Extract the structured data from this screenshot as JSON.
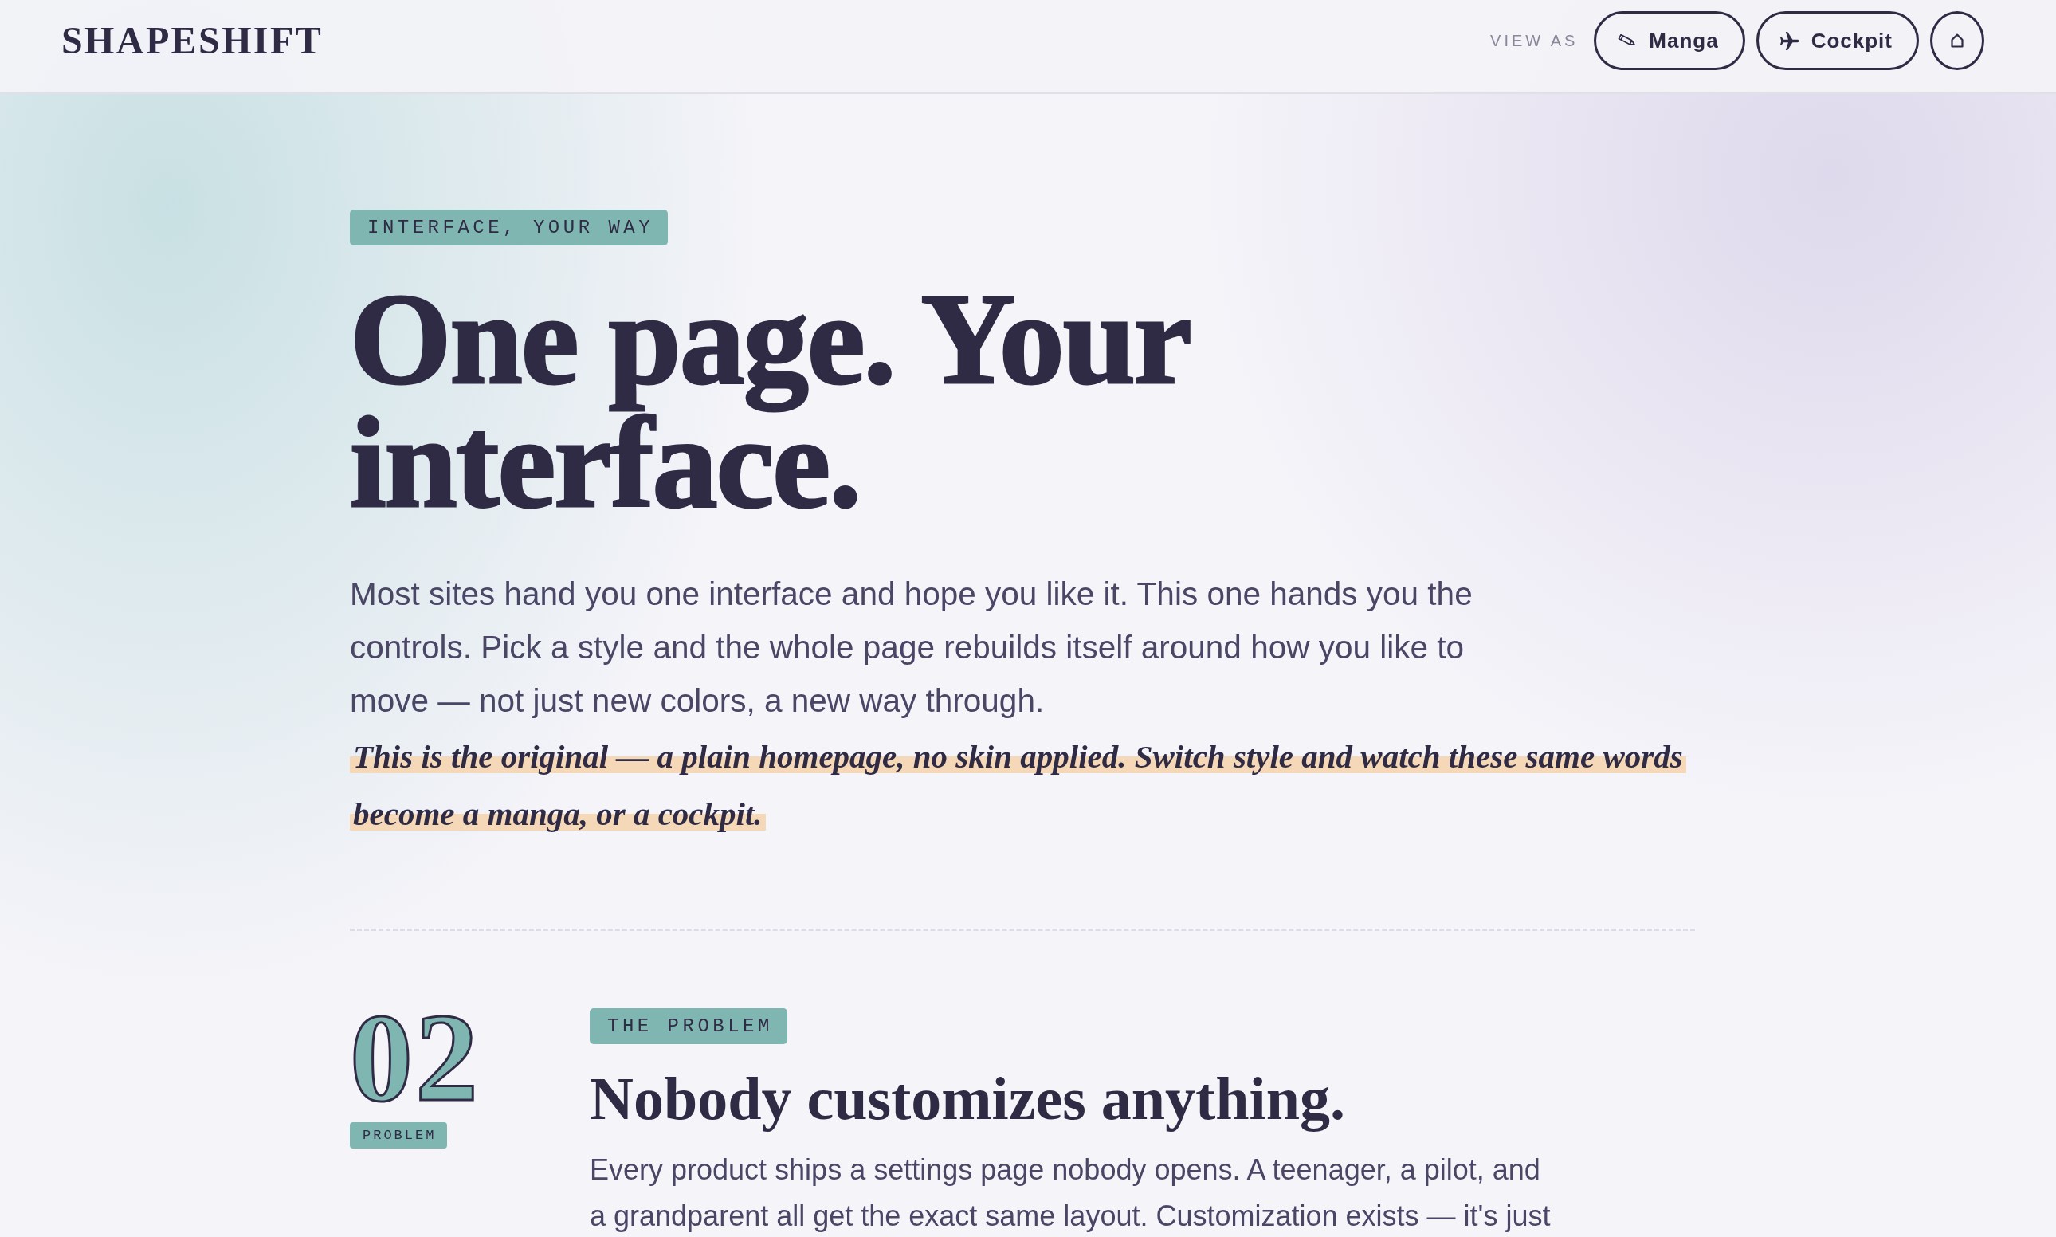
{
  "header": {
    "logo": "SHAPESHIFT",
    "view_label": "VIEW AS",
    "view_buttons": [
      {
        "kind": "manga",
        "label": "Manga"
      },
      {
        "kind": "cockpit",
        "label": "Cockpit"
      },
      {
        "kind": "home"
      }
    ]
  },
  "hero": {
    "eyebrow": "INTERFACE, YOUR WAY",
    "title": "One page. Your interface.",
    "lead": "Most sites hand you one interface and hope you like it. This one hands you the controls. Pick a style and the whole page rebuilds itself around how you like to move — not just new colors, a new way through.",
    "note": "This is the original — a plain homepage, no skin applied. Switch style and watch these same words become a manga, or a cockpit."
  },
  "sections": [
    {
      "number": "02",
      "number_tag": "PROBLEM",
      "eyebrow": "THE PROBLEM",
      "title": "Nobody customizes anything.",
      "body": "Every product ships a settings page nobody opens. A teenager, a pilot, and a grandparent all get the exact same layout. Customization exists — it's just"
    }
  ]
}
